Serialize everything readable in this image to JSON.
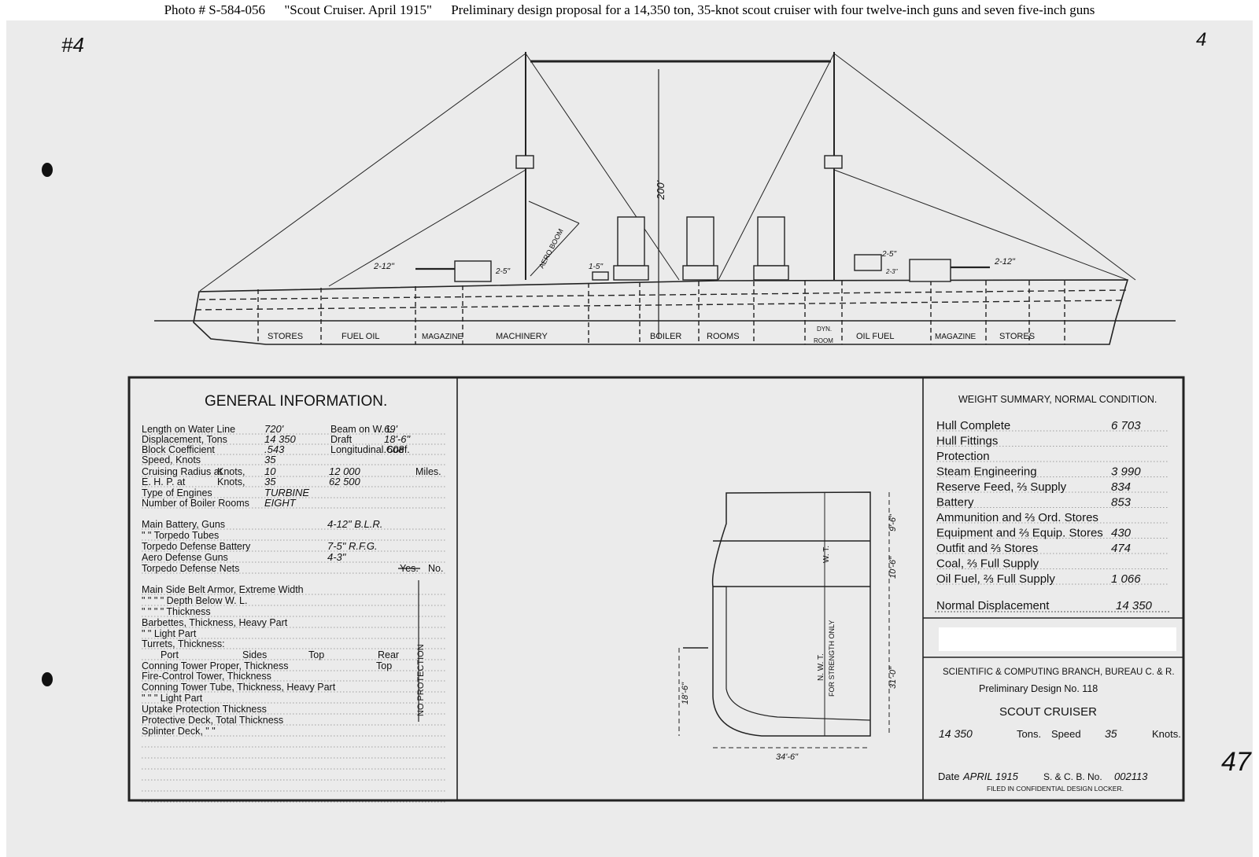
{
  "caption": {
    "photo_label": "Photo #",
    "photo_id": "S-584-056",
    "title": "\"Scout Cruiser. April 1915\"",
    "description": "Preliminary design proposal for a 14,350 ton, 35-knot scout cruiser with four twelve-inch guns and seven five-inch guns"
  },
  "sheet_marks": {
    "top_left": "#4",
    "top_right": "4",
    "right_margin": "47"
  },
  "profile": {
    "mast_height": "200'",
    "fwd_main_gun": "2-12\"",
    "fwd_sec_gun": "2-5\"",
    "mid_gun": "1-5\"",
    "aft_sec_gun": "2-5\"",
    "aft_small": "2-3\"",
    "aft_main_gun": "2-12\"",
    "aero_boom": "AERO BOOM",
    "compartments": [
      "STORES",
      "FUEL OIL",
      "MAGAZINE",
      "MACHINERY",
      "BOILER",
      "ROOMS",
      "OIL FUEL",
      "MAGAZINE",
      "STORES"
    ],
    "dyn_room_1": "DYN.",
    "dyn_room_2": "ROOM"
  },
  "general": {
    "title": "GENERAL INFORMATION.",
    "rows": [
      {
        "label": "Length on Water Line",
        "v1": "720'",
        "label2": "Beam on W. L.",
        "v2": "69'"
      },
      {
        "label": "Displacement, Tons",
        "v1": "14 350",
        "label2": "Draft",
        "v2": "18'-6\""
      },
      {
        "label": "Block Coefficient",
        "v1": ".543",
        "label2": "Longitudinal Coef.",
        "v2": ".608"
      },
      {
        "label": "Speed, Knots",
        "v1": "35"
      },
      {
        "label": "Cruising Radius at",
        "v1": "10",
        "label2": "Knots,",
        "v2": "12 000",
        "label3": "Miles."
      },
      {
        "label": "E. H. P. at",
        "v1": "35",
        "label2": "Knots,",
        "v2": "62 500"
      },
      {
        "label": "Type of Engines",
        "v1": "TURBINE"
      },
      {
        "label": "Number of Boiler Rooms",
        "v1": "EIGHT"
      },
      {
        "label": "Main Battery, Guns",
        "v1": "4-12\" B.L.R."
      },
      {
        "label": "\"      \"      Torpedo Tubes"
      },
      {
        "label": "Torpedo Defense Battery",
        "v1": "7-5\" R.F.G."
      },
      {
        "label": "Aero Defense Guns",
        "v1": "4-3\""
      },
      {
        "label": "Torpedo Defense Nets",
        "yes": "Yes.",
        "no": "No."
      },
      {
        "label": "Main Side Belt Armor, Extreme Width"
      },
      {
        "label": "\"      \"      \"      \"      Depth Below W. L."
      },
      {
        "label": "\"      \"      \"      \"      Thickness"
      },
      {
        "label": "Barbettes, Thickness, Heavy Part"
      },
      {
        "label": "\"      \"      Light Part"
      },
      {
        "label": "Turrets, Thickness:"
      },
      {
        "label": "Port",
        "label2": "Sides",
        "label3": "Top",
        "label4": "Rear"
      },
      {
        "label": "Conning Tower Proper, Thickness",
        "label2": "Top"
      },
      {
        "label": "Fire-Control Tower, Thickness"
      },
      {
        "label": "Conning Tower Tube, Thickness, Heavy Part"
      },
      {
        "label": "\"      \"      \"      Light Part"
      },
      {
        "label": "Uptake Protection Thickness"
      },
      {
        "label": "Protective Deck, Total Thickness"
      },
      {
        "label": "Splinter Deck,      \"      \""
      }
    ],
    "no_protection": "NO PROTECTION"
  },
  "section": {
    "wt": "W. T.",
    "nwt": "N. W. T.",
    "strength": "FOR STRENGTH ONLY",
    "dim_top": "9'-6\"",
    "dim_mid": "10'-6\"",
    "dim_low": "31'-0\"",
    "draft": "18'-6\"",
    "half_beam": "34'-6\""
  },
  "weights": {
    "title": "WEIGHT SUMMARY, NORMAL CONDITION.",
    "items": [
      {
        "label": "Hull Complete",
        "value": "6 703"
      },
      {
        "label": "Hull Fittings",
        "value": ""
      },
      {
        "label": "Protection",
        "value": ""
      },
      {
        "label": "Steam Engineering",
        "value": "3 990"
      },
      {
        "label": "Reserve Feed, ⅔ Supply",
        "value": "834"
      },
      {
        "label": "Battery",
        "value": "853"
      },
      {
        "label": "Ammunition and ⅔ Ord. Stores",
        "value": ""
      },
      {
        "label": "Equipment and ⅔ Equip. Stores",
        "value": "430"
      },
      {
        "label": "Outfit and ⅔ Stores",
        "value": "474"
      },
      {
        "label": "Coal, ⅔ Full Supply",
        "value": ""
      },
      {
        "label": "Oil Fuel, ⅔ Full Supply",
        "value": "1 066"
      }
    ],
    "normal_label": "Normal Displacement",
    "normal_value": "14 350"
  },
  "title_block": {
    "branch": "SCIENTIFIC & COMPUTING BRANCH, BUREAU C. & R.",
    "design": "Preliminary Design No. 118",
    "type": "SCOUT CRUISER",
    "tons_value": "14 350",
    "tons_label": "Tons.",
    "speed_label": "Speed",
    "speed_value": "35",
    "knots_label": "Knots.",
    "date_label": "Date",
    "date_value": "APRIL 1915",
    "scb_label": "S. & C. B. No.",
    "scb_value": "002113",
    "filed": "FILED IN CONFIDENTIAL DESIGN LOCKER."
  }
}
